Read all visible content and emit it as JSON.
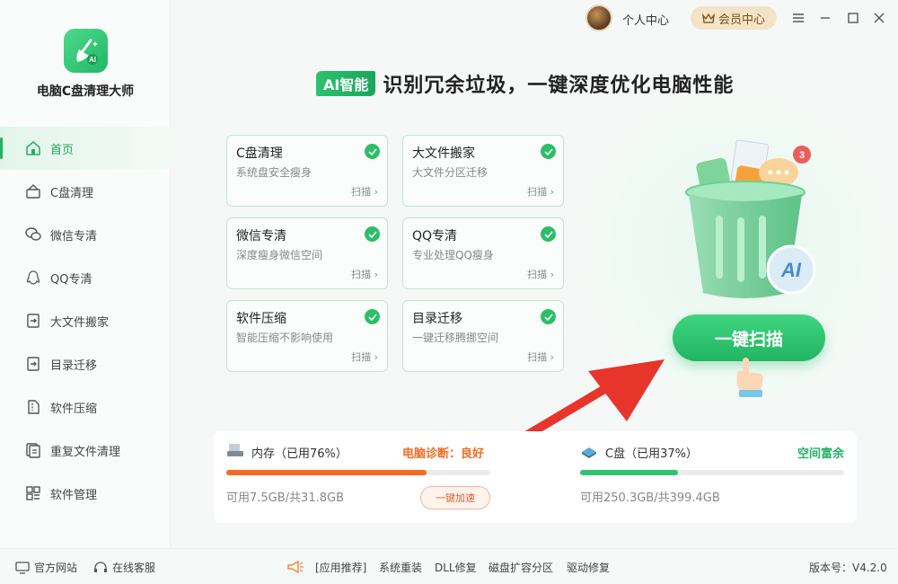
{
  "app": {
    "title": "电脑C盘清理大师"
  },
  "topbar": {
    "user_center": "个人中心",
    "vip_center": "会员中心",
    "controls": [
      "menu-icon",
      "minimize-icon",
      "maximize-icon",
      "close-icon"
    ]
  },
  "sidebar": {
    "items": [
      {
        "label": "首页",
        "icon": "home-icon",
        "active": true
      },
      {
        "label": "C盘清理",
        "icon": "disk-clean-icon"
      },
      {
        "label": "微信专清",
        "icon": "wechat-icon"
      },
      {
        "label": "QQ专清",
        "icon": "qq-icon"
      },
      {
        "label": "大文件搬家",
        "icon": "file-move-icon"
      },
      {
        "label": "目录迁移",
        "icon": "folder-migrate-icon"
      },
      {
        "label": "软件压缩",
        "icon": "zip-icon"
      },
      {
        "label": "重复文件清理",
        "icon": "duplicate-icon"
      },
      {
        "label": "软件管理",
        "icon": "apps-icon"
      }
    ]
  },
  "heading": {
    "tag": "AI智能",
    "text": "识别冗余垃圾，一键深度优化电脑性能"
  },
  "cards": [
    {
      "title": "C盘清理",
      "desc": "系统盘安全瘦身",
      "action": "扫描 ›"
    },
    {
      "title": "大文件搬家",
      "desc": "大文件分区迁移",
      "action": "扫描 ›"
    },
    {
      "title": "微信专清",
      "desc": "深度瘦身微信空间",
      "action": "扫描 ›"
    },
    {
      "title": "QQ专清",
      "desc": "专业处理QQ瘦身",
      "action": "扫描 ›"
    },
    {
      "title": "软件压缩",
      "desc": "智能压缩不影响使用",
      "action": "扫描 ›"
    },
    {
      "title": "目录迁移",
      "desc": "一键迁移腾挪空间",
      "action": "扫描 ›"
    }
  ],
  "main": {
    "scan_button": "一键扫描",
    "badge_count": "3",
    "bin_label": "AI"
  },
  "status": {
    "memory": {
      "label": "内存（已用76%）",
      "used_fraction": 0.76,
      "diagnosis": "电脑诊断：良好",
      "available": "可用7.5GB/共31.8GB",
      "boost": "一键加速"
    },
    "disk": {
      "label": "C盘（已用37%）",
      "used_fraction": 0.37,
      "status": "空间富余",
      "available": "可用250.3GB/共399.4GB"
    }
  },
  "footer": {
    "website": "官方网站",
    "support": "在线客服",
    "links": [
      "[应用推荐]",
      "系统重装",
      "DLL修复",
      "磁盘扩容分区",
      "驱动修复"
    ],
    "version": "版本号：V4.2.0"
  },
  "colors": {
    "accent": "#22b361",
    "warning": "#f26b21",
    "memory_bar": "#f26b21",
    "disk_bar": "#2fc46e"
  }
}
